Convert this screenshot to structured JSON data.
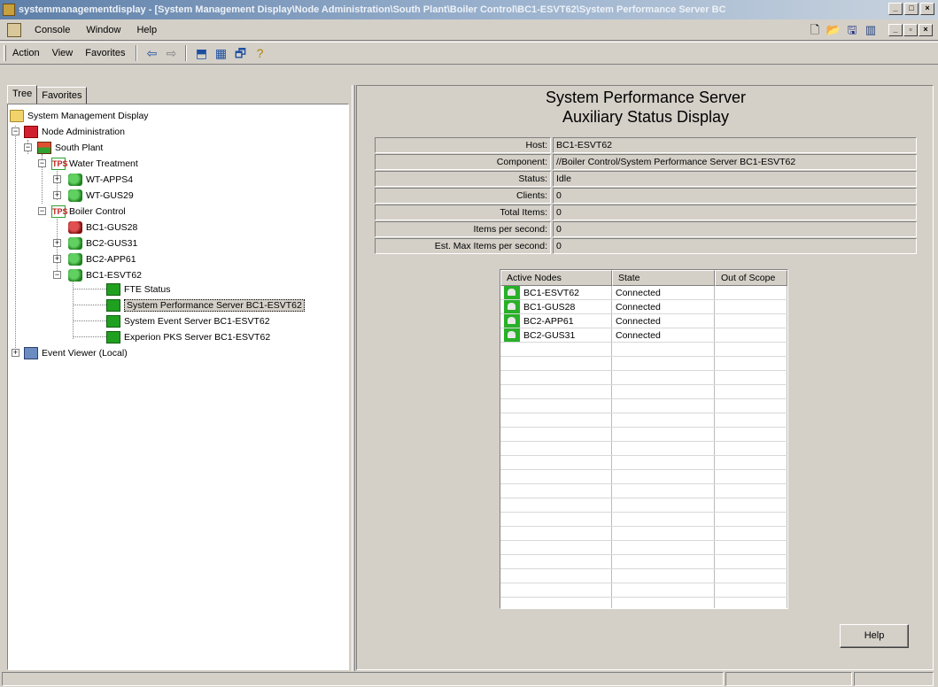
{
  "window": {
    "title": "systemmanagementdisplay - [System Management Display\\Node Administration\\South Plant\\Boiler Control\\BC1-ESVT62\\System Performance Server BC"
  },
  "menubar": {
    "items": [
      "Console",
      "Window",
      "Help"
    ]
  },
  "actionbar": {
    "items": [
      "Action",
      "View",
      "Favorites"
    ]
  },
  "tabs": [
    "Tree",
    "Favorites"
  ],
  "tree": {
    "root": "System Management Display",
    "node_admin": "Node Administration",
    "south_plant": "South Plant",
    "water_treatment": "Water Treatment",
    "wt_apps4": "WT-APPS4",
    "wt_gus29": "WT-GUS29",
    "boiler_control": "Boiler Control",
    "bc1_gus28": "BC1-GUS28",
    "bc2_gus31": "BC2-GUS31",
    "bc2_app61": "BC2-APP61",
    "bc1_esvt62": "BC1-ESVT62",
    "fte_status": "FTE Status",
    "sps": "System Performance Server BC1-ESVT62",
    "ses": "System Event Server BC1-ESVT62",
    "pks": "Experion PKS Server BC1-ESVT62",
    "event_viewer": "Event Viewer (Local)",
    "tps_label": "TPS"
  },
  "display": {
    "title1": "System Performance Server",
    "title2": "Auxiliary Status Display",
    "properties": [
      {
        "label": "Host:",
        "value": "BC1-ESVT62"
      },
      {
        "label": "Component:",
        "value": "//Boiler Control/System Performance Server BC1-ESVT62"
      },
      {
        "label": "Status:",
        "value": "Idle"
      },
      {
        "label": "Clients:",
        "value": "0"
      },
      {
        "label": "Total Items:",
        "value": "0"
      },
      {
        "label": "Items per second:",
        "value": "0"
      },
      {
        "label": "Est. Max Items per second:",
        "value": "0"
      }
    ],
    "grid": {
      "headers": [
        "Active Nodes",
        "State",
        "Out of Scope"
      ],
      "rows": [
        {
          "node": "BC1-ESVT62",
          "state": "Connected",
          "scope": ""
        },
        {
          "node": "BC1-GUS28",
          "state": "Connected",
          "scope": ""
        },
        {
          "node": "BC2-APP61",
          "state": "Connected",
          "scope": ""
        },
        {
          "node": "BC2-GUS31",
          "state": "Connected",
          "scope": ""
        }
      ]
    },
    "help_label": "Help"
  },
  "colors": {
    "node_icon_green": "#28b028",
    "window_bg": "#d4d0c8"
  }
}
